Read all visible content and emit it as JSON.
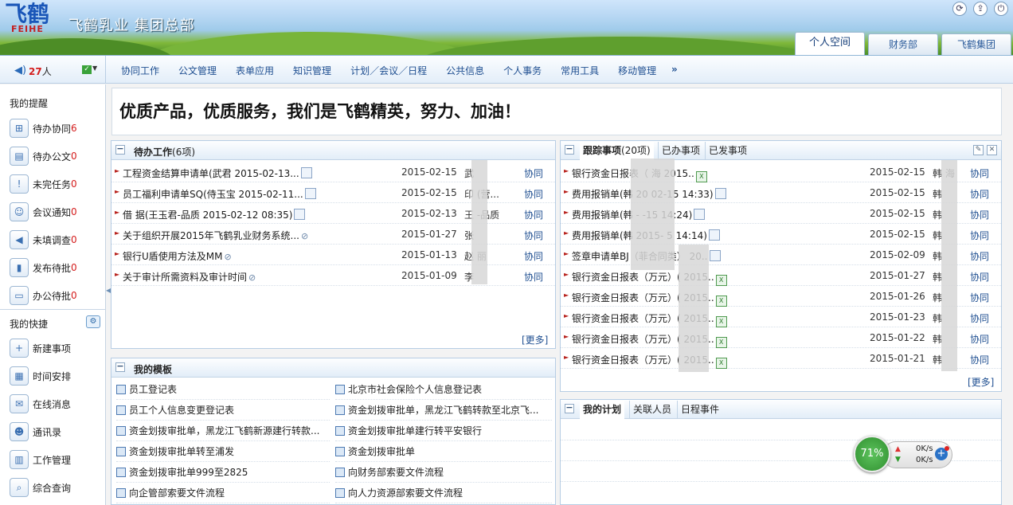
{
  "header": {
    "logo_text": "飞鹤",
    "logo_sub": "FEIHE",
    "title": "飞鹤乳业  集团总部",
    "window_icons": [
      "refresh-icon",
      "export-icon",
      "power-icon"
    ],
    "tabs": [
      {
        "label": "个人空间",
        "active": true
      },
      {
        "label": "财务部",
        "active": false
      },
      {
        "label": "飞鹤集团",
        "active": false
      }
    ]
  },
  "nav": {
    "online_count": "27",
    "online_suffix": "人",
    "menu": [
      "协同工作",
      "公文管理",
      "表单应用",
      "知识管理",
      "计划／会议／日程",
      "公共信息",
      "个人事务",
      "常用工具",
      "移动管理"
    ],
    "more": "»"
  },
  "sidebar": {
    "reminders_title": "我的提醒",
    "reminders": [
      {
        "label": "待办协同",
        "count": "6"
      },
      {
        "label": "待办公文",
        "count": "0"
      },
      {
        "label": "未完任务",
        "count": "0"
      },
      {
        "label": "会议通知",
        "count": "0"
      },
      {
        "label": "未填调查",
        "count": "0"
      },
      {
        "label": "发布待批",
        "count": "0"
      },
      {
        "label": "办公待批",
        "count": "0"
      }
    ],
    "shortcuts_title": "我的快捷",
    "shortcuts": [
      {
        "label": "新建事项"
      },
      {
        "label": "时间安排"
      },
      {
        "label": "在线消息"
      },
      {
        "label": "通讯录"
      },
      {
        "label": "工作管理"
      },
      {
        "label": "综合查询"
      }
    ]
  },
  "slogan": "优质产品，优质服务，我们是飞鹤精英，努力、加油！",
  "pending": {
    "title": "待办工作",
    "count": "(6项)",
    "more": "[更多]",
    "rows": [
      {
        "title": "工程资金结算申请单(武君 2015-02-13...",
        "date": "2015-02-15",
        "person": "武",
        "type": "协同",
        "icon": "doc"
      },
      {
        "title": "员工福利申请单SQ(侍玉宝 2015-02-11...",
        "date": "2015-02-15",
        "person": "印  (营...",
        "type": "协同",
        "icon": "doc"
      },
      {
        "title": "借 据(王玉君-品质 2015-02-12 08:35)",
        "date": "2015-02-13",
        "person": "王  -品质",
        "type": "协同",
        "icon": "doc"
      },
      {
        "title": "关于组织开展2015年飞鹤乳业财务系统...",
        "date": "2015-01-27",
        "person": "张",
        "type": "协同",
        "icon": "clip"
      },
      {
        "title": "银行U盾使用方法及MM",
        "date": "2015-01-13",
        "person": "赵  丽",
        "type": "协同",
        "icon": "clip"
      },
      {
        "title": "关于审计所需资料及审计时间",
        "date": "2015-01-09",
        "person": "李",
        "type": "协同",
        "icon": "clip"
      }
    ]
  },
  "tracking": {
    "tabs": [
      {
        "label": "跟踪事项",
        "count": "(20项)",
        "active": true
      },
      {
        "label": "已办事项",
        "active": false
      },
      {
        "label": "已发事项",
        "active": false
      }
    ],
    "more": "[更多]",
    "rows": [
      {
        "title": "银行资金日报表（         海 2015..",
        "date": "2015-02-15",
        "person": "韩  海",
        "type": "协同",
        "icon": "xls"
      },
      {
        "title": "费用报销单(韩       20  02-15 14:33)",
        "date": "2015-02-15",
        "person": "韩",
        "type": "协同",
        "icon": "doc"
      },
      {
        "title": "费用报销单(韩       -  -15 14:24)",
        "date": "2015-02-15",
        "person": "韩",
        "type": "协同",
        "icon": "doc"
      },
      {
        "title": "费用报销单(韩    2015-   5 14:14)",
        "date": "2015-02-15",
        "person": "韩",
        "type": "协同",
        "icon": "doc"
      },
      {
        "title": "签章申请单BJ（菲合同类）      20..",
        "date": "2015-02-09",
        "person": "韩",
        "type": "协同",
        "icon": "doc"
      },
      {
        "title": "银行资金日报表（万元）(      2015..",
        "date": "2015-01-27",
        "person": "韩",
        "type": "协同",
        "icon": "xls"
      },
      {
        "title": "银行资金日报表（万元）(      2015..",
        "date": "2015-01-26",
        "person": "韩",
        "type": "协同",
        "icon": "xls"
      },
      {
        "title": "银行资金日报表（万元）(      2015..",
        "date": "2015-01-23",
        "person": "韩",
        "type": "协同",
        "icon": "xls"
      },
      {
        "title": "银行资金日报表（万元）(      2015..",
        "date": "2015-01-22",
        "person": "韩",
        "type": "协同",
        "icon": "xls"
      },
      {
        "title": "银行资金日报表（万元）(      2015..",
        "date": "2015-01-21",
        "person": "韩",
        "type": "协同",
        "icon": "xls"
      }
    ]
  },
  "templates": {
    "title": "我的模板",
    "left": [
      "员工登记表",
      "员工个人信息变更登记表",
      "资金划拨审批单，黑龙江飞鹤新源建行转款...",
      "资金划拨审批单转至浦发",
      "资金划拨审批单999至2825",
      "向企管部索要文件流程"
    ],
    "right": [
      "北京市社会保险个人信息登记表",
      "资金划拨审批单，黑龙江飞鹤转款至北京飞...",
      "资金划拨审批单建行转平安银行",
      "资金划拨审批单",
      "向财务部索要文件流程",
      "向人力资源部索要文件流程"
    ]
  },
  "plan": {
    "tabs": [
      {
        "label": "我的计划",
        "active": true
      },
      {
        "label": "关联人员",
        "active": false
      },
      {
        "label": "日程事件",
        "active": false
      }
    ]
  },
  "network": {
    "percent": "71%",
    "up": "0K/s",
    "down": "0K/s"
  }
}
